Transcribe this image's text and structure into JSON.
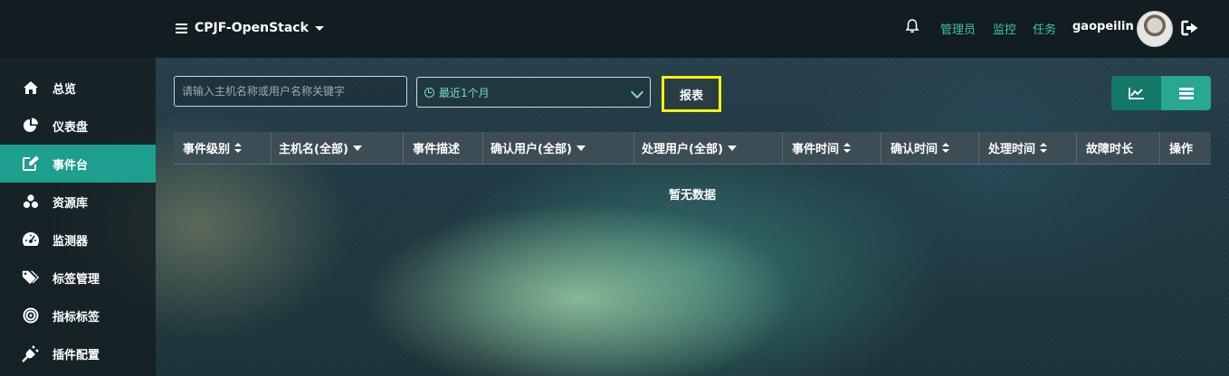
{
  "header": {
    "project_name": "CPJF-OpenStack",
    "links": [
      "管理员",
      "监控",
      "任务"
    ],
    "username": "gaopeilin",
    "icons": [
      "list-icon",
      "caret-down-icon",
      "bell-icon",
      "avatar",
      "logout-icon"
    ]
  },
  "sidebar": {
    "items": [
      {
        "label": "总览",
        "icon": "home-icon"
      },
      {
        "label": "仪表盘",
        "icon": "pie-chart-icon"
      },
      {
        "label": "事件台",
        "icon": "edit-icon",
        "active": true
      },
      {
        "label": "资源库",
        "icon": "cubes-icon"
      },
      {
        "label": "监测器",
        "icon": "dashboard-icon"
      },
      {
        "label": "标签管理",
        "icon": "tags-icon"
      },
      {
        "label": "指标标签",
        "icon": "target-icon"
      },
      {
        "label": "插件配置",
        "icon": "plug-icon"
      }
    ]
  },
  "toolbar": {
    "search_placeholder": "请输入主机名称或用户名称关键字",
    "time_range": "最近1个月",
    "report_label": "报表"
  },
  "table": {
    "columns": [
      {
        "label": "事件级别",
        "control": "sort"
      },
      {
        "label": "主机名(全部)",
        "control": "filter"
      },
      {
        "label": "事件描述",
        "control": "none"
      },
      {
        "label": "确认用户(全部)",
        "control": "filter"
      },
      {
        "label": "处理用户(全部)",
        "control": "filter"
      },
      {
        "label": "事件时间",
        "control": "sort"
      },
      {
        "label": "确认时间",
        "control": "sort"
      },
      {
        "label": "处理时间",
        "control": "sort"
      },
      {
        "label": "故障时长",
        "control": "none"
      },
      {
        "label": "操作",
        "control": "none"
      }
    ],
    "empty_text": "暂无数据"
  },
  "colors": {
    "accent": "#1e9e8d",
    "link": "#3fbfae",
    "highlight": "#f4f40a"
  }
}
